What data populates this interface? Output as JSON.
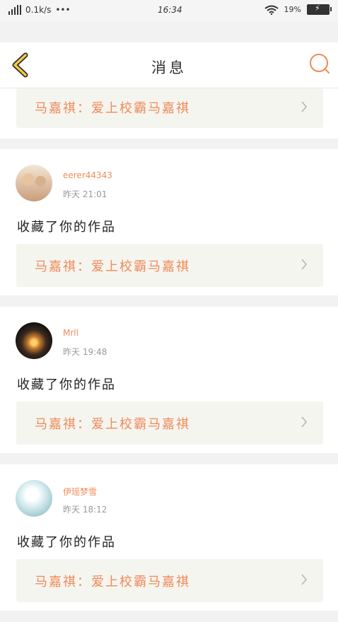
{
  "status_bar": {
    "network_speed": "0.1k/s",
    "dots": "•••",
    "time": "16:34",
    "battery_percent": "19%"
  },
  "header": {
    "title": "消息"
  },
  "messages": [
    {
      "work_title": "马嘉祺：爱上校霸马嘉祺"
    },
    {
      "username": "eerer44343",
      "time": "昨天 21:01",
      "text": "收藏了你的作品",
      "work_title": "马嘉祺：爱上校霸马嘉祺"
    },
    {
      "username": "Mrll",
      "time": "昨天 19:48",
      "text": "收藏了你的作品",
      "work_title": "马嘉祺：爱上校霸马嘉祺"
    },
    {
      "username": "伊瑶梦雪",
      "time": "昨天 18:12",
      "text": "收藏了你的作品",
      "work_title": "马嘉祺：爱上校霸马嘉祺"
    }
  ],
  "colors": {
    "accent": "#f08a5a",
    "back_icon": "#f5c842",
    "card_bg": "#f5f5ef"
  },
  "icons": {
    "back": "chevron-left-icon",
    "search": "search-icon",
    "link": "chevron-right-icon"
  }
}
